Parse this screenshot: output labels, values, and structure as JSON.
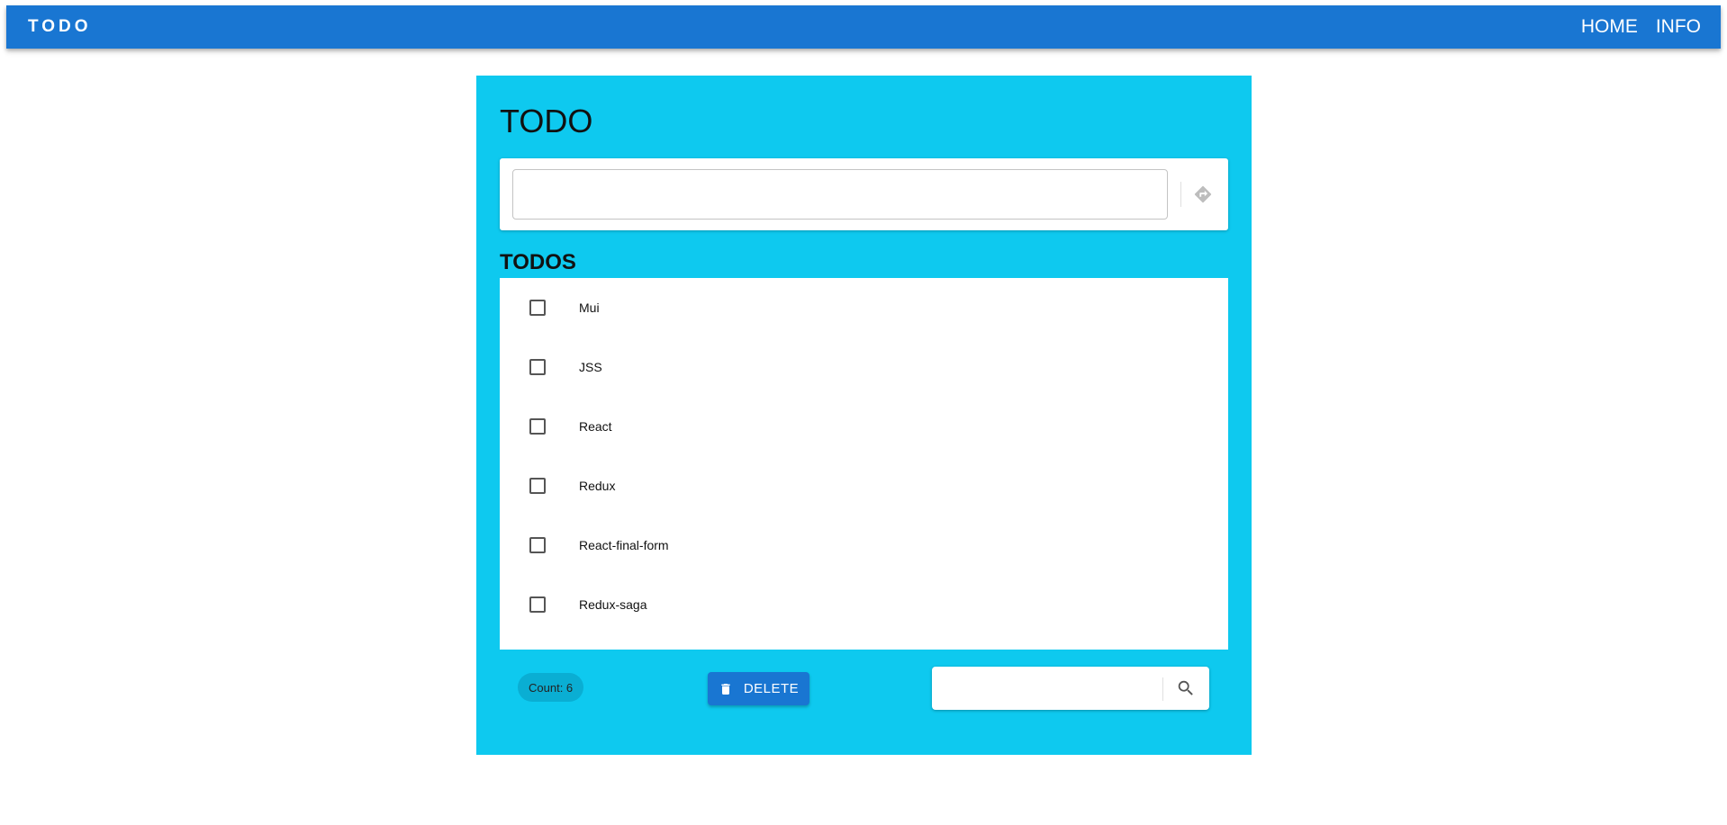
{
  "appbar": {
    "brand": "TODO",
    "nav": [
      {
        "label": "HOME"
      },
      {
        "label": "INFO"
      }
    ],
    "color": "#1976d2"
  },
  "main": {
    "title": "TODO",
    "add_input": {
      "value": "",
      "placeholder": ""
    },
    "add_icon": "directions-icon",
    "list_title": "TODOS",
    "todos": [
      {
        "label": "Mui",
        "checked": false
      },
      {
        "label": "JSS",
        "checked": false
      },
      {
        "label": "React",
        "checked": false
      },
      {
        "label": "Redux",
        "checked": false
      },
      {
        "label": "React-final-form",
        "checked": false
      },
      {
        "label": "Redux-saga",
        "checked": false
      }
    ],
    "count_label": "Count: 6",
    "delete_label": "DELETE",
    "delete_icon": "trash-icon",
    "search_input": {
      "value": "",
      "placeholder": ""
    },
    "search_icon": "search-icon",
    "panel_color": "#0ec9ef"
  }
}
